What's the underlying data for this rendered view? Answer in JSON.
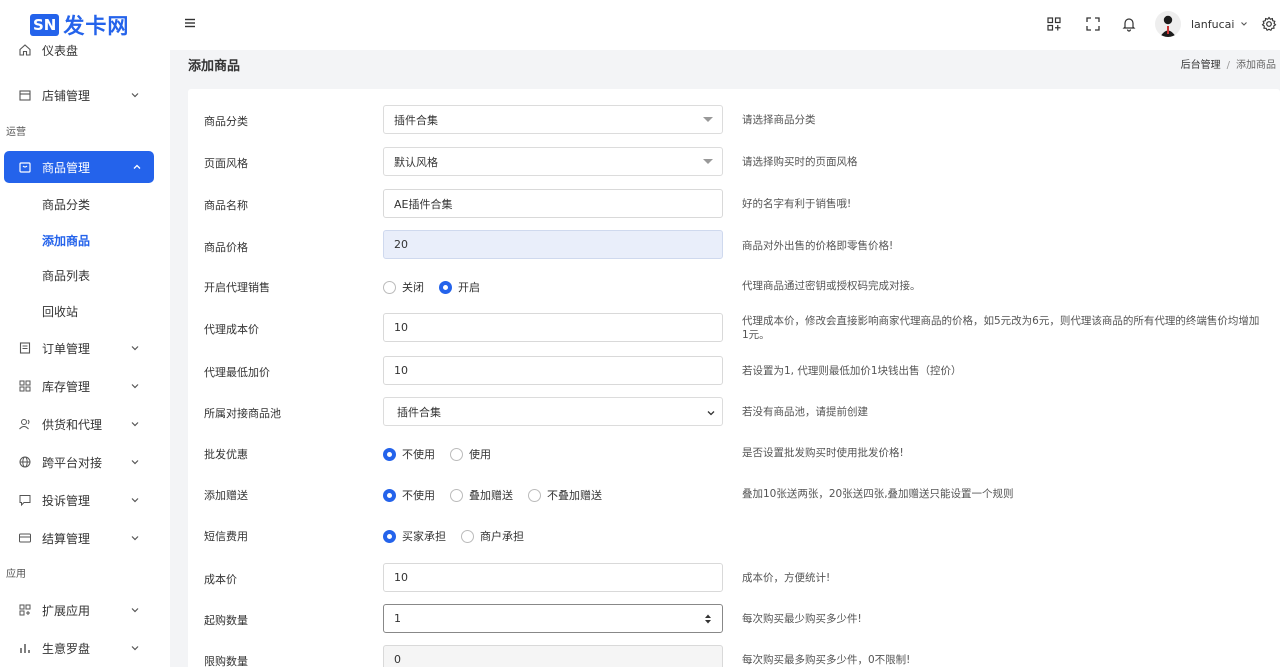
{
  "brand": {
    "badge": "SN",
    "name": "发卡网"
  },
  "sidebar": {
    "items": [
      {
        "label": "仪表盘"
      },
      {
        "label": "店铺管理"
      }
    ],
    "group_ops": "运营",
    "active": {
      "label": "商品管理"
    },
    "sub_items": [
      {
        "label": "商品分类"
      },
      {
        "label": "添加商品"
      },
      {
        "label": "商品列表"
      },
      {
        "label": "回收站"
      }
    ],
    "items2": [
      {
        "label": "订单管理"
      },
      {
        "label": "库存管理"
      },
      {
        "label": "供货和代理"
      },
      {
        "label": "跨平台对接"
      },
      {
        "label": "投诉管理"
      },
      {
        "label": "结算管理"
      }
    ],
    "group_apps": "应用",
    "items3": [
      {
        "label": "扩展应用"
      },
      {
        "label": "生意罗盘"
      }
    ]
  },
  "header": {
    "username": "lanfucai"
  },
  "page": {
    "title": "添加商品",
    "breadcrumb": [
      "后台管理",
      "添加商品"
    ]
  },
  "form": {
    "category": {
      "label": "商品分类",
      "value": "插件合集",
      "hint": "请选择商品分类"
    },
    "style": {
      "label": "页面风格",
      "value": "默认风格",
      "hint": "请选择购买时的页面风格"
    },
    "name": {
      "label": "商品名称",
      "value": "AE插件合集",
      "hint": "好的名字有利于销售哦!"
    },
    "price": {
      "label": "商品价格",
      "value": "20",
      "hint": "商品对外出售的价格即零售价格!"
    },
    "agent_sale": {
      "label": "开启代理销售",
      "options": [
        "关闭",
        "开启"
      ],
      "selected": 1,
      "hint": "代理商品通过密钥或授权码完成对接。"
    },
    "agent_cost": {
      "label": "代理成本价",
      "value": "10",
      "hint": "代理成本价，修改会直接影响商家代理商品的价格，如5元改为6元，则代理该商品的所有代理的终端售价均增加1元。"
    },
    "agent_min_markup": {
      "label": "代理最低加价",
      "value": "10",
      "hint": "若设置为1, 代理则最低加价1块钱出售（控价）"
    },
    "pool": {
      "label": "所属对接商品池",
      "value": "插件合集",
      "hint": "若没有商品池，请提前创建"
    },
    "wholesale": {
      "label": "批发优惠",
      "options": [
        "不使用",
        "使用"
      ],
      "selected": 0,
      "hint": "是否设置批发购买时使用批发价格!"
    },
    "gift": {
      "label": "添加赠送",
      "options": [
        "不使用",
        "叠加赠送",
        "不叠加赠送"
      ],
      "selected": 0,
      "hint": "叠加10张送两张，20张送四张,叠加赠送只能设置一个规则"
    },
    "sms": {
      "label": "短信费用",
      "options": [
        "买家承担",
        "商户承担"
      ],
      "selected": 0
    },
    "cost": {
      "label": "成本价",
      "value": "10",
      "hint": "成本价，方便统计!"
    },
    "min_qty": {
      "label": "起购数量",
      "value": "1",
      "hint": "每次购买最少购买多少件!"
    },
    "max_qty": {
      "label": "限购数量",
      "value": "0",
      "hint": "每次购买最多购买多少件，0不限制!"
    }
  },
  "colors": {
    "accent": "#2463eb",
    "readonly_bg": "#e9eefa"
  }
}
